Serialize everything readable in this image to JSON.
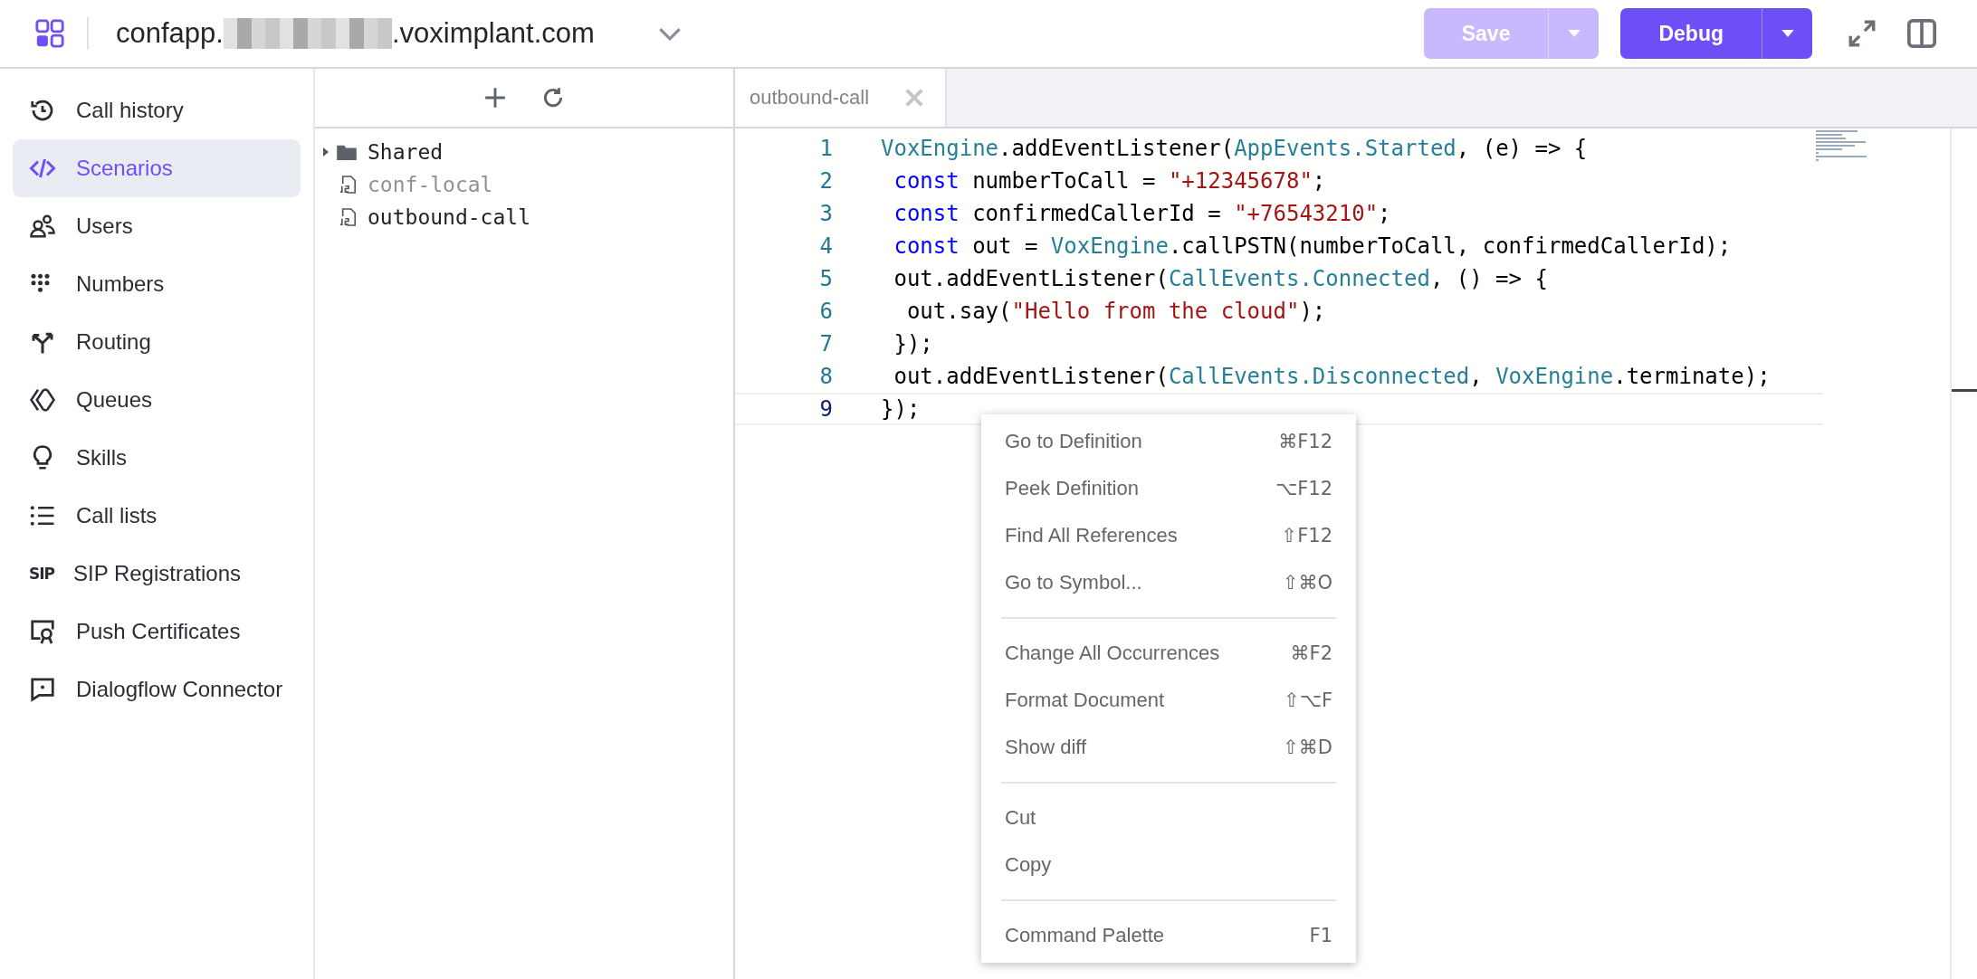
{
  "header": {
    "domain_prefix": "confapp.",
    "domain_suffix": ".voximplant.com",
    "save_button": {
      "label": "Save",
      "disabled": true
    },
    "debug_button": {
      "label": "Debug",
      "disabled": false
    }
  },
  "sidebar": {
    "items": [
      {
        "label": "Call history",
        "selected": false
      },
      {
        "label": "Scenarios",
        "selected": true
      },
      {
        "label": "Users",
        "selected": false
      },
      {
        "label": "Numbers",
        "selected": false
      },
      {
        "label": "Routing",
        "selected": false
      },
      {
        "label": "Queues",
        "selected": false
      },
      {
        "label": "Skills",
        "selected": false
      },
      {
        "label": "Call lists",
        "selected": false
      },
      {
        "label": "SIP Registrations",
        "selected": false,
        "icon_text": "SIP"
      },
      {
        "label": "Push Certificates",
        "selected": false
      },
      {
        "label": "Dialogflow Connector",
        "selected": false
      }
    ]
  },
  "file_tree": {
    "items": [
      {
        "kind": "folder",
        "name": "Shared",
        "expanded": false
      },
      {
        "kind": "file",
        "name": "conf-local",
        "disabled": true
      },
      {
        "kind": "file",
        "name": "outbound-call",
        "disabled": false
      }
    ]
  },
  "editor": {
    "tabs": [
      {
        "label": "outbound-call",
        "selected": true
      }
    ],
    "lines": [
      {
        "number": "1",
        "current": false,
        "tokens": [
          {
            "kind": "cls",
            "text": "VoxEngine"
          },
          {
            "kind": "txt",
            "text": ".addEventListener("
          },
          {
            "kind": "cls",
            "text": "AppEvents.Started"
          },
          {
            "kind": "txt",
            "text": ", (e) => {"
          }
        ]
      },
      {
        "number": "2",
        "current": false,
        "tokens": [
          {
            "kind": "kw",
            "text": " const"
          },
          {
            "kind": "txt",
            "text": " numberToCall = "
          },
          {
            "kind": "str",
            "text": "\"+12345678\""
          },
          {
            "kind": "txt",
            "text": ";"
          }
        ]
      },
      {
        "number": "3",
        "current": false,
        "tokens": [
          {
            "kind": "kw",
            "text": " const"
          },
          {
            "kind": "txt",
            "text": " confirmedCallerId = "
          },
          {
            "kind": "str",
            "text": "\"+76543210\""
          },
          {
            "kind": "txt",
            "text": ";"
          }
        ]
      },
      {
        "number": "4",
        "current": false,
        "tokens": [
          {
            "kind": "kw",
            "text": " const"
          },
          {
            "kind": "txt",
            "text": " out = "
          },
          {
            "kind": "cls",
            "text": "VoxEngine"
          },
          {
            "kind": "txt",
            "text": ".callPSTN(numberToCall, confirmedCallerId);"
          }
        ]
      },
      {
        "number": "5",
        "current": false,
        "tokens": [
          {
            "kind": "txt",
            "text": " out.addEventListener("
          },
          {
            "kind": "cls",
            "text": "CallEvents.Connected"
          },
          {
            "kind": "txt",
            "text": ", () => {"
          }
        ]
      },
      {
        "number": "6",
        "current": false,
        "tokens": [
          {
            "kind": "txt",
            "text": "  out.say("
          },
          {
            "kind": "str",
            "text": "\"Hello from the cloud\""
          },
          {
            "kind": "txt",
            "text": ");"
          }
        ]
      },
      {
        "number": "7",
        "current": false,
        "tokens": [
          {
            "kind": "txt",
            "text": " });"
          }
        ]
      },
      {
        "number": "8",
        "current": false,
        "tokens": [
          {
            "kind": "txt",
            "text": " out.addEventListener("
          },
          {
            "kind": "cls",
            "text": "CallEvents.Disconnected"
          },
          {
            "kind": "txt",
            "text": ", "
          },
          {
            "kind": "cls",
            "text": "VoxEngine"
          },
          {
            "kind": "txt",
            "text": ".terminate);"
          }
        ]
      },
      {
        "number": "9",
        "current": true,
        "tokens": [
          {
            "kind": "txt",
            "text": "});"
          }
        ]
      }
    ]
  },
  "context_menu": {
    "groups": [
      [
        {
          "label": "Go to Definition",
          "shortcut": "⌘F12"
        },
        {
          "label": "Peek Definition",
          "shortcut": "⌥F12"
        },
        {
          "label": "Find All References",
          "shortcut": "⇧F12"
        },
        {
          "label": "Go to Symbol...",
          "shortcut": "⇧⌘O"
        }
      ],
      [
        {
          "label": "Change All Occurrences",
          "shortcut": "⌘F2"
        },
        {
          "label": "Format Document",
          "shortcut": "⇧⌥F"
        },
        {
          "label": "Show diff",
          "shortcut": "⇧⌘D"
        }
      ],
      [
        {
          "label": "Cut"
        },
        {
          "label": "Copy"
        }
      ],
      [
        {
          "label": "Command Palette",
          "shortcut": "F1"
        }
      ]
    ]
  }
}
